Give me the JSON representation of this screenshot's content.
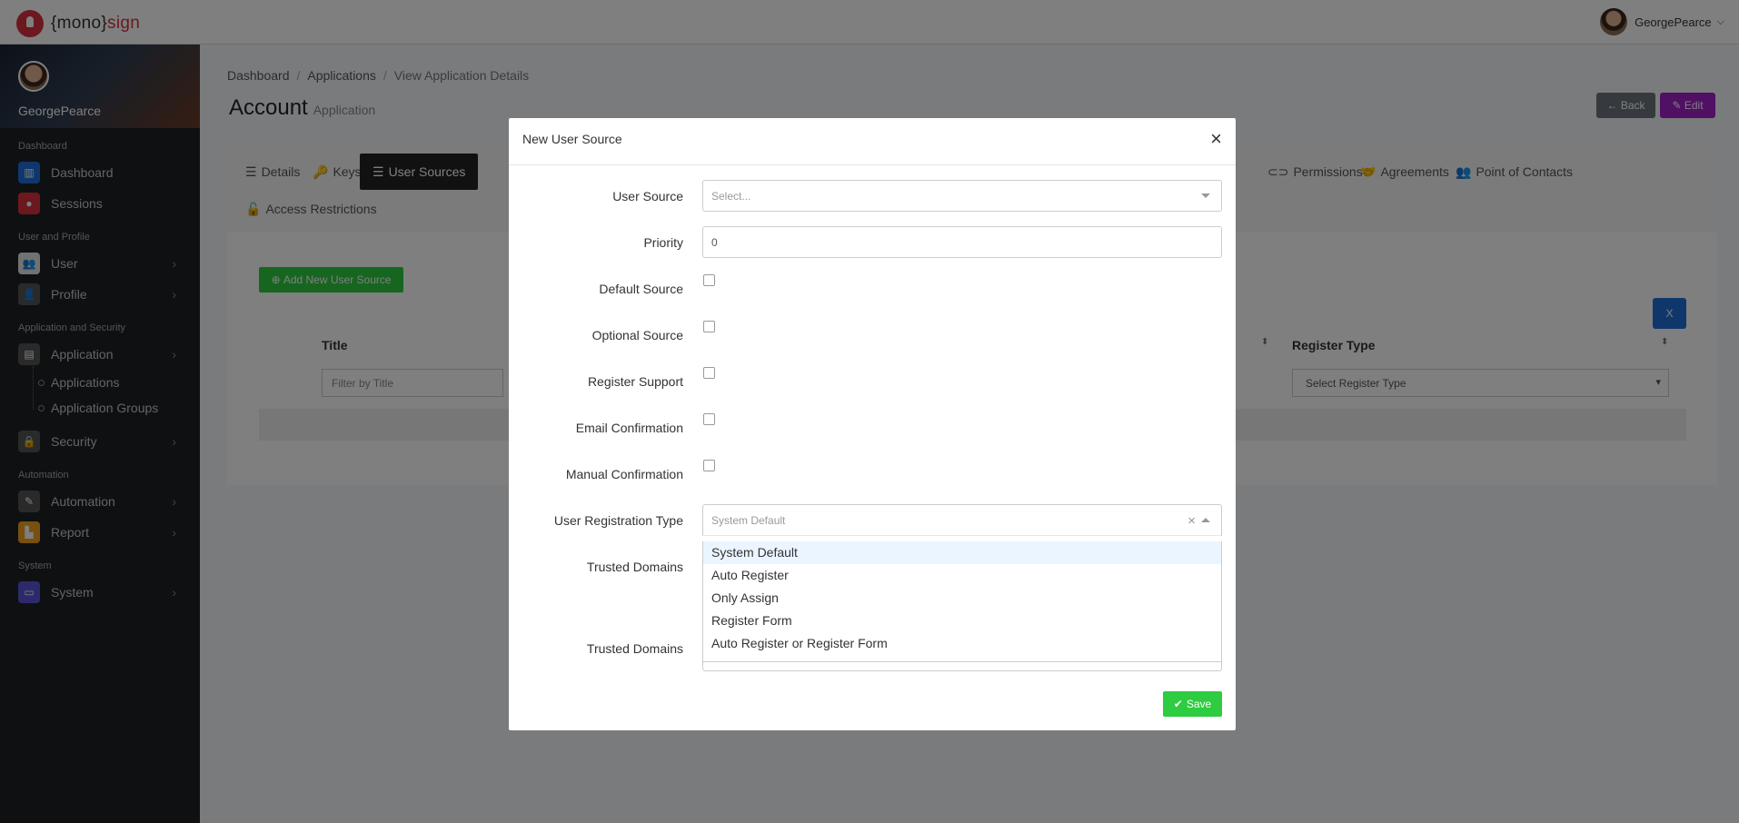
{
  "topbar": {
    "logo_prefix": "{mono}",
    "logo_suffix": "sign",
    "user_name": "GeorgePearce"
  },
  "sidebar": {
    "user_name": "GeorgePearce",
    "sections": {
      "dashboard": "Dashboard",
      "user_profile": "User and Profile",
      "app_security": "Application and Security",
      "automation": "Automation",
      "system": "System"
    },
    "items": {
      "dashboard": "Dashboard",
      "sessions": "Sessions",
      "user": "User",
      "profile": "Profile",
      "application": "Application",
      "applications": "Applications",
      "application_groups": "Application Groups",
      "security": "Security",
      "automation": "Automation",
      "report": "Report",
      "system": "System"
    },
    "colors": {
      "dashboard": "#1e6ed8",
      "sessions": "#d9313e",
      "user": "#e5e5e5",
      "profile": "#555555",
      "application": "#555555",
      "security": "#555555",
      "automation": "#555555",
      "report": "#f0a020",
      "system": "#5a55d8"
    }
  },
  "breadcrumb": {
    "item1": "Dashboard",
    "item2": "Applications",
    "item3": "View Application Details",
    "sep": "/"
  },
  "page": {
    "title": "Account",
    "subtitle": "Application",
    "back_label": "← Back",
    "edit_label": "Edit"
  },
  "tabs": {
    "details": "Details",
    "keys": "Keys",
    "user_sources": "User Sources",
    "partial": "s",
    "permissions": "Permissions",
    "agreements": "Agreements",
    "point_of_contacts": "Point of Contacts",
    "access_restrictions": "Access Restrictions"
  },
  "list": {
    "add_button": "Add New User Source",
    "col_title": "Title",
    "col_register_type": "Register Type",
    "filter_title_placeholder": "Filter by Title",
    "filter_register_type": "Select Register Type"
  },
  "modal": {
    "title": "New User Source",
    "close": "×",
    "fields": {
      "user_source_label": "User Source",
      "user_source_placeholder": "Select...",
      "priority_label": "Priority",
      "priority_value": "0",
      "default_source_label": "Default Source",
      "optional_source_label": "Optional Source",
      "register_support_label": "Register Support",
      "email_confirmation_label": "Email Confirmation",
      "manual_confirmation_label": "Manual Confirmation",
      "registration_type_label": "User Registration Type",
      "registration_type_placeholder": "System Default",
      "trusted_domains_label_1": "Trusted Domains",
      "trusted_domains_label_2": "Trusted Domains"
    },
    "dropdown_options": [
      "System Default",
      "Auto Register",
      "Only Assign",
      "Register Form",
      "Auto Register or Register Form"
    ],
    "save_label": "Save"
  }
}
